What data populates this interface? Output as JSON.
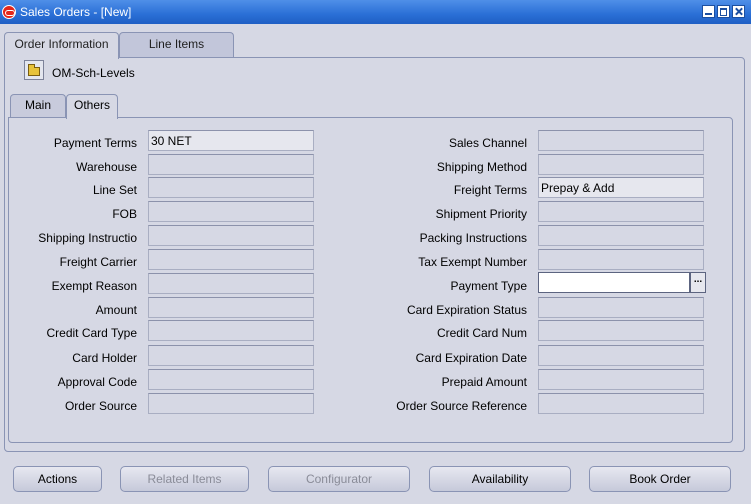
{
  "window": {
    "title": "Sales Orders - [New]"
  },
  "tabs": [
    {
      "label": "Order Information"
    },
    {
      "label": "Line Items"
    }
  ],
  "folder": {
    "name": "OM-Sch-Levels"
  },
  "subtabs": [
    {
      "label": "Main"
    },
    {
      "label": "Others"
    }
  ],
  "left_fields": [
    {
      "label": "Payment Terms",
      "value": "30 NET"
    },
    {
      "label": "Warehouse",
      "value": ""
    },
    {
      "label": "Line Set",
      "value": ""
    },
    {
      "label": "FOB",
      "value": ""
    },
    {
      "label": "Shipping Instructio",
      "value": ""
    },
    {
      "label": "Freight Carrier",
      "value": ""
    },
    {
      "label": "Exempt Reason",
      "value": ""
    },
    {
      "label": "Amount",
      "value": ""
    },
    {
      "label": "Credit Card Type",
      "value": ""
    },
    {
      "label": "Card Holder",
      "value": ""
    },
    {
      "label": "Approval Code",
      "value": ""
    },
    {
      "label": "Order Source",
      "value": ""
    }
  ],
  "right_fields": [
    {
      "label": "Sales Channel",
      "value": ""
    },
    {
      "label": "Shipping Method",
      "value": ""
    },
    {
      "label": "Freight Terms",
      "value": "Prepay & Add"
    },
    {
      "label": "Shipment Priority",
      "value": ""
    },
    {
      "label": "Packing Instructions",
      "value": ""
    },
    {
      "label": "Tax Exempt Number",
      "value": ""
    },
    {
      "label": "Payment Type",
      "value": ""
    },
    {
      "label": "Card Expiration Status",
      "value": ""
    },
    {
      "label": "Credit Card Num",
      "value": ""
    },
    {
      "label": "Card Expiration Date",
      "value": ""
    },
    {
      "label": "Prepaid Amount",
      "value": ""
    },
    {
      "label": "Order Source Reference",
      "value": ""
    }
  ],
  "lov_button": {
    "label": "..."
  },
  "buttons": [
    {
      "label": "Actions",
      "enabled": true
    },
    {
      "label": "Related Items",
      "enabled": false
    },
    {
      "label": "Configurator",
      "enabled": false
    },
    {
      "label": "Availability",
      "enabled": true
    },
    {
      "label": "Book Order",
      "enabled": true
    }
  ]
}
